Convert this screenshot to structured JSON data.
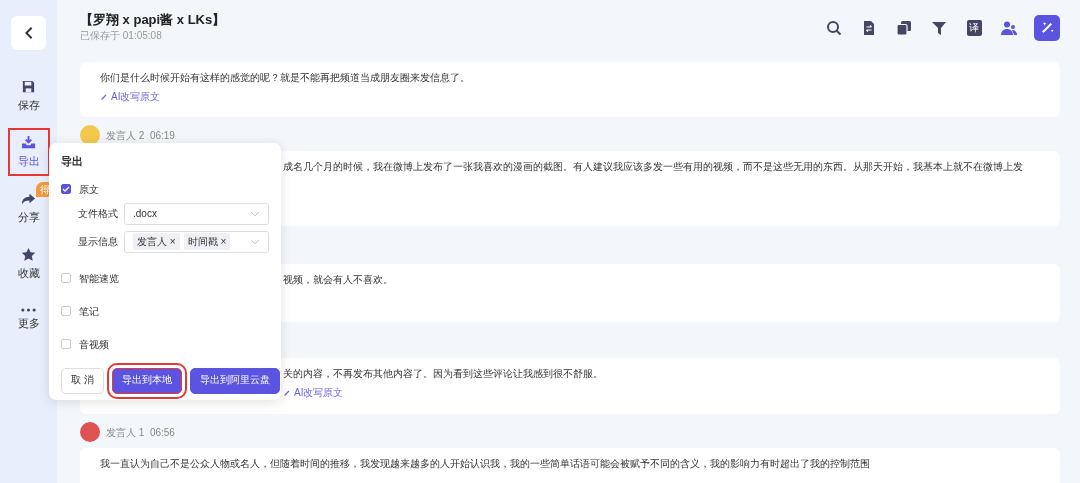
{
  "sidebar": {
    "items": [
      {
        "label": "保存",
        "selected": false,
        "highlighted": false
      },
      {
        "label": "导出",
        "selected": true,
        "highlighted": true
      },
      {
        "label": "分享",
        "selected": false,
        "highlighted": false,
        "badge": "得"
      },
      {
        "label": "收藏",
        "selected": false,
        "highlighted": false
      },
      {
        "label": "更多",
        "selected": false,
        "highlighted": false
      }
    ]
  },
  "header": {
    "title": "【罗翔 x papi酱 x LKs】",
    "saved": "已保存于 01:05:08",
    "tools": [
      {
        "kind": "icon"
      },
      {
        "kind": "icon"
      },
      {
        "kind": "icon"
      },
      {
        "kind": "icon"
      },
      {
        "kind": "text",
        "text": "译"
      },
      {
        "kind": "icon"
      },
      {
        "kind": "icon"
      }
    ]
  },
  "segments": [
    {
      "text": "你们是什么时候开始有这样的感觉的呢？就是不能再把频道当成朋友圈来发信息了。",
      "ai_link": "AI改写原文"
    },
    {
      "speaker": "发言人 2",
      "time": "06:19",
      "color": "#f2c94c",
      "text": "成名几个月的时候，我在微博上发布了一张我喜欢的漫画的截图。有人建议我应该多发一些有用的视频，而不是这些无用的东西。从那天开始，我基本上就不在微博上发"
    },
    {
      "text": "视频，就会有人不喜欢。"
    },
    {
      "text": "关的内容，不再发布其他内容了。因为看到这些评论让我感到很不舒服。",
      "ai_link": "AI改写原文"
    },
    {
      "speaker": "发言人 1",
      "time": "06:56",
      "color": "#e05252",
      "text": "我一直认为自己不是公众人物或名人，但随着时间的推移，我发现越来越多的人开始认识我，我的一些简单话语可能会被赋予不同的含义，我的影响力有时超出了我的控制范围"
    }
  ],
  "export_dialog": {
    "title": "导出",
    "options": [
      {
        "kind": "format",
        "label": "原文",
        "checked": true,
        "fields": [
          {
            "label": "文件格式",
            "value": ".docx"
          },
          {
            "label": "显示信息",
            "tags": [
              {
                "label": "发言人",
                "remove": "×"
              },
              {
                "label": "时间戳",
                "remove": "×"
              }
            ]
          }
        ]
      },
      {
        "kind": "plain",
        "label": "智能速览",
        "checked": false
      },
      {
        "kind": "plain",
        "label": "笔记",
        "checked": false
      },
      {
        "kind": "plain",
        "label": "音视频",
        "checked": false
      }
    ],
    "buttons": [
      {
        "label": "取 消",
        "primary": false,
        "highlighted": false
      },
      {
        "label": "导出到本地",
        "primary": true,
        "highlighted": true
      },
      {
        "label": "导出到阿里云盘",
        "primary": true,
        "highlighted": false
      }
    ]
  }
}
